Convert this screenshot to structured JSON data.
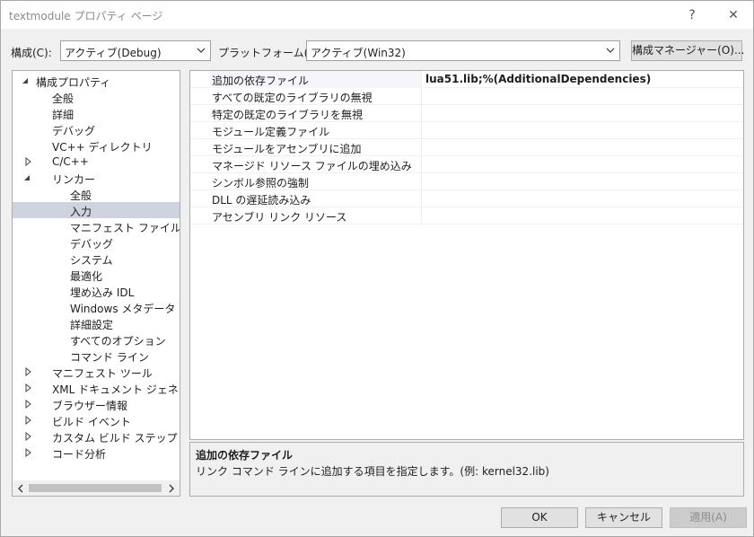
{
  "window": {
    "title": "textmodule プロパティ ページ",
    "help_glyph": "?",
    "close_glyph": "✕"
  },
  "config": {
    "config_label": "構成(C):",
    "config_value": "アクティブ(Debug)",
    "platform_label": "プラットフォーム(P):",
    "platform_value": "アクティブ(Win32)",
    "manager_button": "構成マネージャー(O)..."
  },
  "tree": {
    "items": [
      {
        "label": "構成プロパティ",
        "level": 0,
        "expander": "expanded"
      },
      {
        "label": "全般",
        "level": 1,
        "expander": "none"
      },
      {
        "label": "詳細",
        "level": 1,
        "expander": "none"
      },
      {
        "label": "デバッグ",
        "level": 1,
        "expander": "none"
      },
      {
        "label": "VC++ ディレクトリ",
        "level": 1,
        "expander": "none"
      },
      {
        "label": "C/C++",
        "level": 1,
        "expander": "collapsed"
      },
      {
        "label": "リンカー",
        "level": 1,
        "expander": "expanded"
      },
      {
        "label": "全般",
        "level": 2,
        "expander": "none"
      },
      {
        "label": "入力",
        "level": 2,
        "expander": "none",
        "selected": true
      },
      {
        "label": "マニフェスト ファイル",
        "level": 2,
        "expander": "none"
      },
      {
        "label": "デバッグ",
        "level": 2,
        "expander": "none"
      },
      {
        "label": "システム",
        "level": 2,
        "expander": "none"
      },
      {
        "label": "最適化",
        "level": 2,
        "expander": "none"
      },
      {
        "label": "埋め込み IDL",
        "level": 2,
        "expander": "none"
      },
      {
        "label": "Windows メタデータ",
        "level": 2,
        "expander": "none"
      },
      {
        "label": "詳細設定",
        "level": 2,
        "expander": "none"
      },
      {
        "label": "すべてのオプション",
        "level": 2,
        "expander": "none"
      },
      {
        "label": "コマンド ライン",
        "level": 2,
        "expander": "none"
      },
      {
        "label": "マニフェスト ツール",
        "level": 1,
        "expander": "collapsed"
      },
      {
        "label": "XML ドキュメント ジェネレーター",
        "level": 1,
        "expander": "collapsed"
      },
      {
        "label": "ブラウザー情報",
        "level": 1,
        "expander": "collapsed"
      },
      {
        "label": "ビルド イベント",
        "level": 1,
        "expander": "collapsed"
      },
      {
        "label": "カスタム ビルド ステップ",
        "level": 1,
        "expander": "collapsed"
      },
      {
        "label": "コード分析",
        "level": 1,
        "expander": "collapsed"
      }
    ]
  },
  "properties": [
    {
      "name": "追加の依存ファイル",
      "value": "lua51.lib;%(AdditionalDependencies)"
    },
    {
      "name": "すべての既定のライブラリの無視",
      "value": ""
    },
    {
      "name": "特定の既定のライブラリを無視",
      "value": ""
    },
    {
      "name": "モジュール定義ファイル",
      "value": ""
    },
    {
      "name": "モジュールをアセンブリに追加",
      "value": ""
    },
    {
      "name": "マネージド リソース ファイルの埋め込み",
      "value": ""
    },
    {
      "name": "シンボル参照の強制",
      "value": ""
    },
    {
      "name": "DLL の遅延読み込み",
      "value": ""
    },
    {
      "name": "アセンブリ リンク リソース",
      "value": ""
    }
  ],
  "description": {
    "title": "追加の依存ファイル",
    "body": "リンク コマンド ラインに追加する項目を指定します。(例: kernel32.lib)"
  },
  "buttons": {
    "ok": "OK",
    "cancel": "キャンセル",
    "apply": "適用(A)"
  }
}
